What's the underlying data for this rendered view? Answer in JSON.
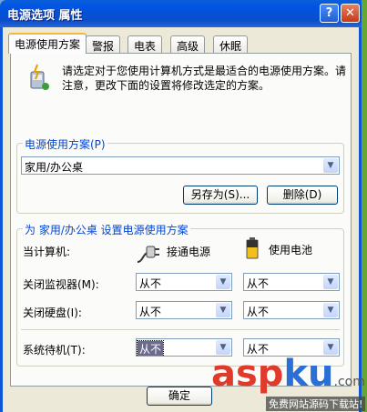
{
  "window": {
    "title": "电源选项 属性",
    "help_glyph": "?",
    "close_glyph": "✕"
  },
  "tabs": [
    {
      "label": "电源使用方案",
      "active": true
    },
    {
      "label": "警报"
    },
    {
      "label": "电表"
    },
    {
      "label": "高级"
    },
    {
      "label": "休眠"
    }
  ],
  "intro": {
    "text_line1": "请选定对于您使用计算机方式是最适合的电源使用方案。请",
    "text_line2": "注意，更改下面的设置将修改选定的方案。"
  },
  "scheme": {
    "group_label": "电源使用方案(P)",
    "selected": "家用/办公桌",
    "save_as_label": "另存为(S)...",
    "delete_label": "删除(D)"
  },
  "settings": {
    "group_label": "为 家用/办公桌 设置电源使用方案",
    "when_label": "当计算机:",
    "plugged_label": "接通电源",
    "battery_label": "使用电池",
    "rows": [
      {
        "label": "关闭监视器(M):",
        "ac": "从不",
        "dc": "从不"
      },
      {
        "label": "关闭硬盘(I):",
        "ac": "从不",
        "dc": "从不"
      },
      {
        "label": "系统待机(T):",
        "ac": "从不",
        "dc": "从不"
      }
    ]
  },
  "ok_label": "确定",
  "watermark": {
    "part1": "asp",
    "part2": "ku",
    "suffix": ".com",
    "sub": "免费网站源码下载站!"
  },
  "colors": {
    "title_bar": "#0054e3",
    "face": "#ece9d8",
    "group_label": "#0046d5",
    "watermark_red": "#e03a2a",
    "watermark_blue": "#2a6fd6"
  }
}
